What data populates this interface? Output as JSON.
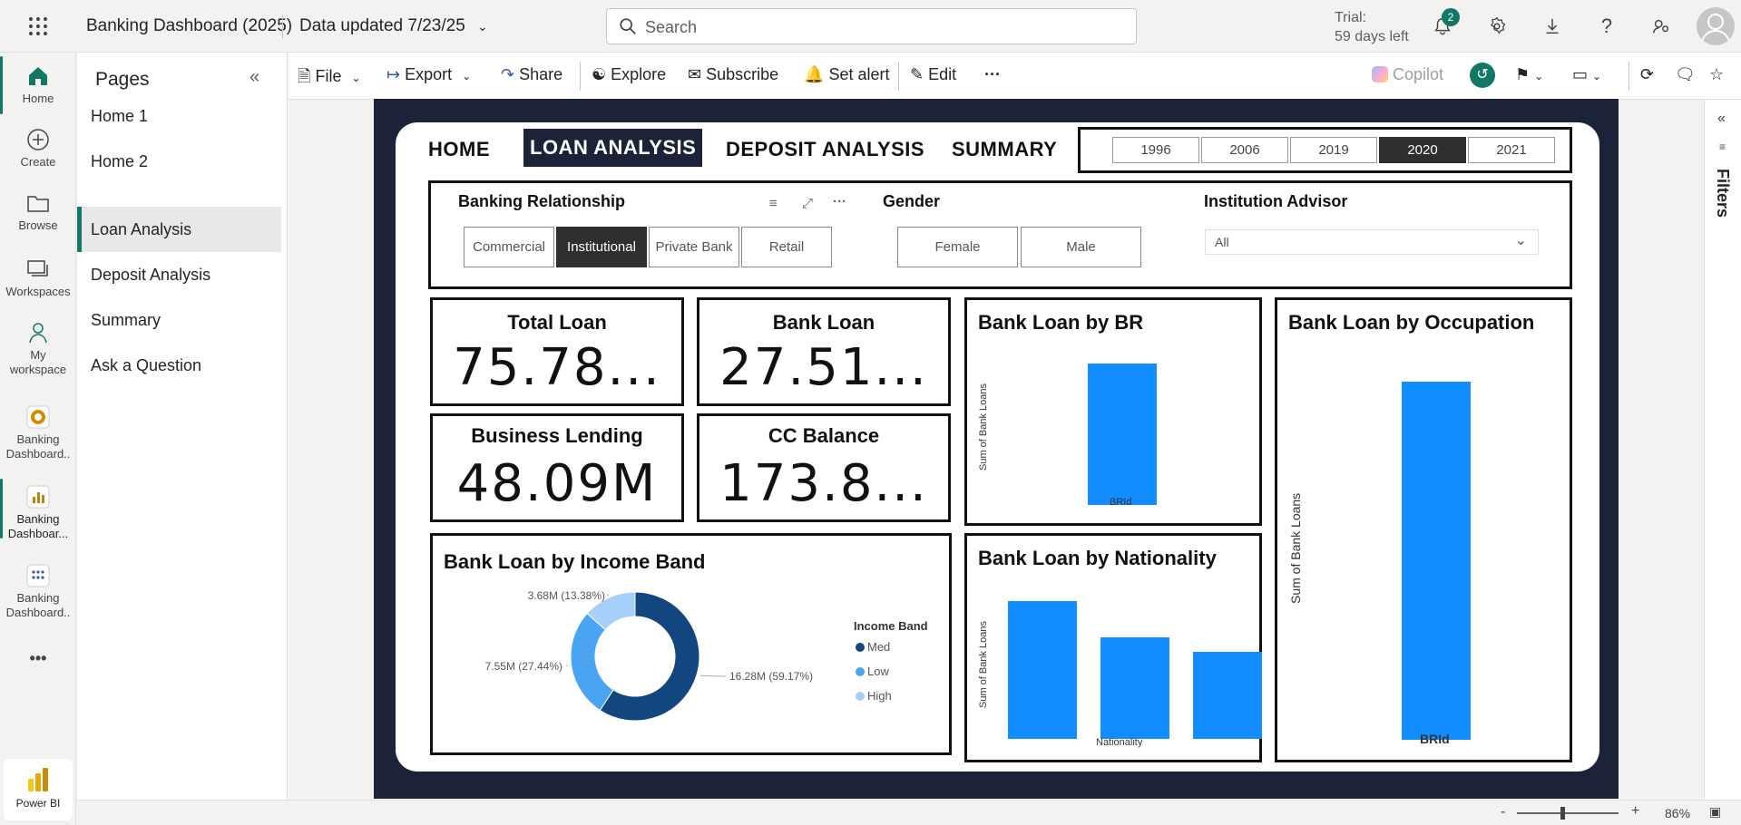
{
  "header": {
    "app_title": "Banking Dashboard (2025)",
    "data_updated": "Data updated 7/23/25",
    "search_placeholder": "Search",
    "trial_line1": "Trial:",
    "trial_line2": "59 days left",
    "notification_count": "2"
  },
  "leftnav": {
    "items": [
      {
        "label": "Home"
      },
      {
        "label": "Create"
      },
      {
        "label": "Browse"
      },
      {
        "label": "Workspaces"
      },
      {
        "label": "My workspace"
      },
      {
        "label": "Banking Dashboard.."
      },
      {
        "label": "Banking Dashboar..."
      },
      {
        "label": "Banking Dashboard.."
      }
    ],
    "more": "•••",
    "product": "Power BI"
  },
  "pages": {
    "title": "Pages",
    "items": [
      "Home 1",
      "Home 2",
      "Loan Analysis",
      "Deposit Analysis",
      "Summary",
      "Ask a Question"
    ],
    "selected": "Loan Analysis"
  },
  "toolbar": {
    "file": "File",
    "export": "Export",
    "share": "Share",
    "explore": "Explore",
    "subscribe": "Subscribe",
    "set_alert": "Set alert",
    "edit": "Edit",
    "more": "···",
    "copilot": "Copilot"
  },
  "report": {
    "tabs": [
      "HOME",
      "LOAN ANALYSIS",
      "DEPOSIT ANALYSIS",
      "SUMMARY"
    ],
    "active_tab": "LOAN ANALYSIS",
    "years": [
      "1996",
      "2006",
      "2019",
      "2020",
      "2021"
    ],
    "selected_year": "2020",
    "slicers": {
      "banking_relationship": {
        "title": "Banking Relationship",
        "options": [
          "Commercial",
          "Institutional",
          "Private Bank",
          "Retail"
        ],
        "selected": "Institutional"
      },
      "gender": {
        "title": "Gender",
        "options": [
          "Female",
          "Male"
        ]
      },
      "institution_advisor": {
        "title": "Institution Advisor",
        "value": "All"
      }
    },
    "kpis": [
      {
        "title": "Total Loan",
        "value": "75.78..."
      },
      {
        "title": "Bank Loan",
        "value": "27.51..."
      },
      {
        "title": "Business Lending",
        "value": "48.09M"
      },
      {
        "title": "CC Balance",
        "value": "173.8..."
      }
    ],
    "visuals": {
      "br": {
        "title": "Bank Loan by BR",
        "ylabel": "Sum of Bank Loans",
        "xlabel": "BRId"
      },
      "occupation": {
        "title": "Bank Loan by Occupation",
        "ylabel": "Sum of Bank Loans",
        "xlabel": "BRId"
      },
      "income": {
        "title": "Bank Loan by Income Band",
        "legend_title": "Income Band"
      },
      "nationality": {
        "title": "Bank Loan by Nationality",
        "ylabel": "Sum of Bank Loans",
        "xlabel": "Nationality"
      }
    }
  },
  "rightpane": {
    "filters_label": "Filters"
  },
  "statusbar": {
    "zoom": "86%"
  },
  "colors": {
    "accent": "#117865",
    "bar": "#118dff",
    "navy": "#1c2338",
    "med": "#12467e",
    "low": "#4aa4f2",
    "high": "#a6d0fa"
  },
  "chart_data": [
    {
      "type": "pie",
      "title": "Bank Loan by Income Band",
      "legend_title": "Income Band",
      "categories": [
        "Med",
        "Low",
        "High"
      ],
      "values": [
        16.28,
        7.55,
        3.68
      ],
      "labels": [
        "16.28M (59.17%)",
        "7.55M (27.44%)",
        "3.68M (13.38%)"
      ],
      "units": "M"
    },
    {
      "type": "bar",
      "title": "Bank Loan by BR",
      "xlabel": "BRId",
      "ylabel": "Sum of Bank Loans",
      "values": [
        1
      ]
    },
    {
      "type": "bar",
      "title": "Bank Loan by Nationality",
      "xlabel": "Nationality",
      "ylabel": "Sum of Bank Loans",
      "values": [
        1.0,
        0.74,
        0.63
      ]
    },
    {
      "type": "bar",
      "title": "Bank Loan by Occupation",
      "xlabel": "BRId",
      "ylabel": "Sum of Bank Loans",
      "values": [
        1
      ]
    }
  ]
}
